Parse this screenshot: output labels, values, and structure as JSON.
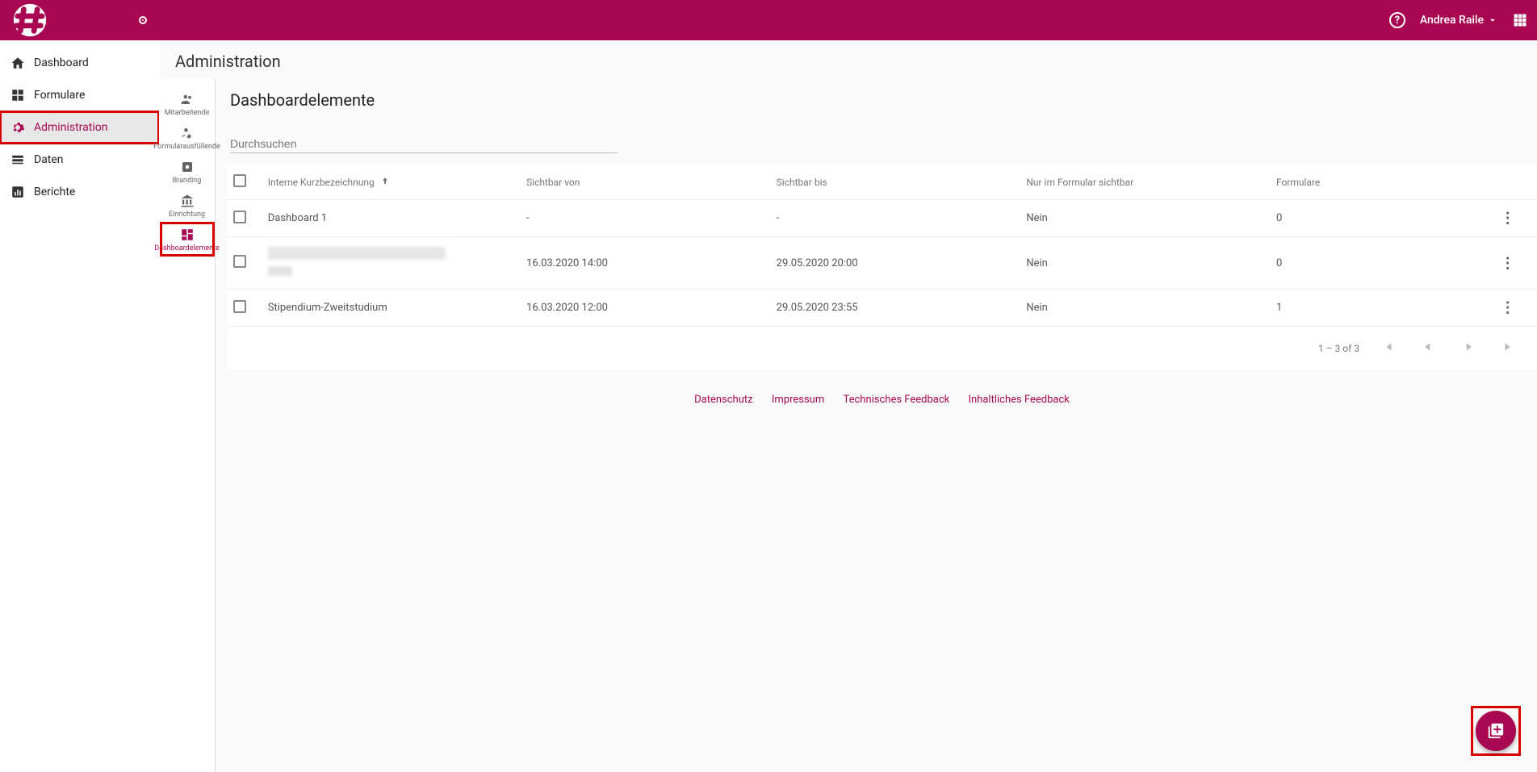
{
  "header": {
    "user_name": "Andrea Raile"
  },
  "nav": {
    "items": [
      {
        "label": "Dashboard"
      },
      {
        "label": "Formulare"
      },
      {
        "label": "Administration"
      },
      {
        "label": "Daten"
      },
      {
        "label": "Berichte"
      }
    ]
  },
  "page": {
    "title": "Administration"
  },
  "subnav": {
    "items": [
      {
        "label": "Mitarbeitende"
      },
      {
        "label": "Formularausfüllende"
      },
      {
        "label": "Branding"
      },
      {
        "label": "Einrichtung"
      },
      {
        "label": "Dashboardelemente"
      }
    ]
  },
  "section": {
    "title": "Dashboardelemente"
  },
  "search": {
    "placeholder": "Durchsuchen"
  },
  "table": {
    "headers": {
      "name": "Interne Kurzbezeichnung",
      "von": "Sichtbar von",
      "bis": "Sichtbar bis",
      "only": "Nur im Formular sichtbar",
      "forms": "Formulare"
    },
    "rows": [
      {
        "name": "Dashboard 1",
        "von": "-",
        "bis": "-",
        "only": "Nein",
        "forms": "0",
        "redacted": false
      },
      {
        "name": "",
        "von": "16.03.2020 14:00",
        "bis": "29.05.2020 20:00",
        "only": "Nein",
        "forms": "0",
        "redacted": true
      },
      {
        "name": "Stipendium-Zweitstudium",
        "von": "16.03.2020 12:00",
        "bis": "29.05.2020 23:55",
        "only": "Nein",
        "forms": "1",
        "redacted": false
      }
    ]
  },
  "pagination": {
    "label": "1 – 3 of 3"
  },
  "footer": {
    "links": [
      "Datenschutz",
      "Impressum",
      "Technisches Feedback",
      "Inhaltliches Feedback"
    ]
  }
}
